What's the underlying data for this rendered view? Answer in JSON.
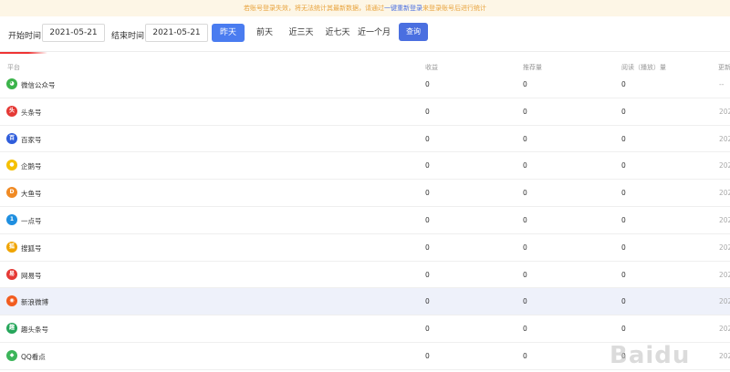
{
  "notice": {
    "text_before": "若账号登录失效，将无法统计其最新数据，请通过",
    "link": "一键重新登录",
    "text_after": "来登录账号后进行统计"
  },
  "filters": {
    "start_label": "开始时间",
    "start_value": "2021-05-21",
    "end_label": "结束时间",
    "end_value": "2021-05-21",
    "quick": [
      "昨天",
      "前天",
      "近三天",
      "近七天",
      "近一个月"
    ],
    "active_quick": "昨天",
    "search_label": "查询"
  },
  "table": {
    "columns": [
      "平台",
      "收益",
      "推荐量",
      "阅读（播放）量",
      "更新"
    ],
    "rows": [
      {
        "platform": "微信公众号",
        "icon": "wechat-icon",
        "color": "#3bb34a",
        "glyph": "◕",
        "income": "0",
        "recommend": "0",
        "views": "0",
        "updated": "--"
      },
      {
        "platform": "头条号",
        "icon": "toutiao-icon",
        "color": "#e53935",
        "glyph": "头",
        "income": "0",
        "recommend": "0",
        "views": "0",
        "updated": "202"
      },
      {
        "platform": "百家号",
        "icon": "baijiahao-icon",
        "color": "#2f5ddb",
        "glyph": "百",
        "income": "0",
        "recommend": "0",
        "views": "0",
        "updated": "202"
      },
      {
        "platform": "企鹅号",
        "icon": "penguin-icon",
        "color": "#f5c000",
        "glyph": "●",
        "income": "0",
        "recommend": "0",
        "views": "0",
        "updated": "202"
      },
      {
        "platform": "大鱼号",
        "icon": "dayu-icon",
        "color": "#f08a24",
        "glyph": "D",
        "income": "0",
        "recommend": "0",
        "views": "0",
        "updated": "202"
      },
      {
        "platform": "一点号",
        "icon": "yidian-icon",
        "color": "#1f8fe0",
        "glyph": "1",
        "income": "0",
        "recommend": "0",
        "views": "0",
        "updated": "202"
      },
      {
        "platform": "搜狐号",
        "icon": "sohu-icon",
        "color": "#f0a400",
        "glyph": "狐",
        "income": "0",
        "recommend": "0",
        "views": "0",
        "updated": "202"
      },
      {
        "platform": "网易号",
        "icon": "netease-icon",
        "color": "#e53935",
        "glyph": "易",
        "income": "0",
        "recommend": "0",
        "views": "0",
        "updated": "202"
      },
      {
        "platform": "新浪微博",
        "icon": "weibo-icon",
        "color": "#f25c1f",
        "glyph": "◉",
        "income": "0",
        "recommend": "0",
        "views": "0",
        "updated": "202"
      },
      {
        "platform": "趣头条号",
        "icon": "qutoutiao-icon",
        "color": "#26a65b",
        "glyph": "趣",
        "income": "0",
        "recommend": "0",
        "views": "0",
        "updated": "202"
      },
      {
        "platform": "QQ看点",
        "icon": "qqkandian-icon",
        "color": "#3cb55a",
        "glyph": "◆",
        "income": "0",
        "recommend": "0",
        "views": "0",
        "updated": "202"
      }
    ]
  },
  "watermark": "Baidu"
}
